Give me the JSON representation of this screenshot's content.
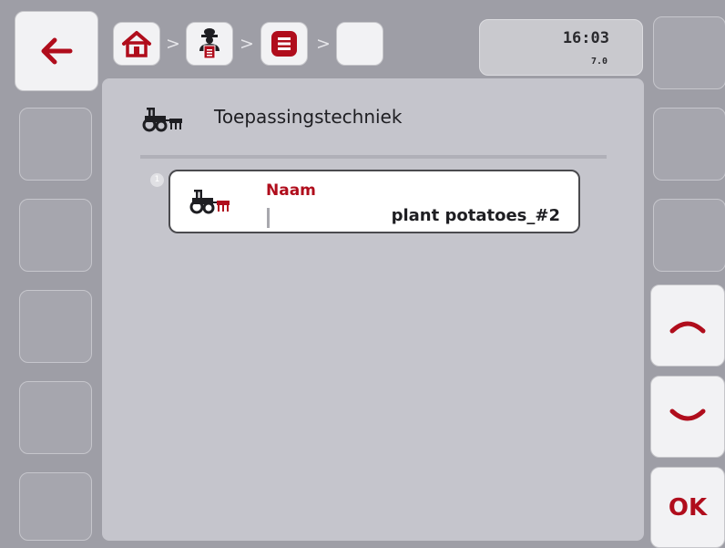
{
  "nav": {
    "back_icon": "arrow-left-icon"
  },
  "breadcrumbs": [
    {
      "icon": "home-icon"
    },
    {
      "icon": "operator-icon"
    },
    {
      "icon": "list-menu-icon"
    },
    {
      "icon": ""
    }
  ],
  "breadcrumb_separator": ">",
  "status": {
    "time": "16:03",
    "version": "7.0"
  },
  "header": {
    "title": "Toepassingstechniek",
    "icon": "tractor-implement-icon"
  },
  "list": {
    "items": [
      {
        "index": "1",
        "label": "Naam",
        "value": "plant potatoes_#2",
        "icon": "tractor-implement-icon"
      }
    ]
  },
  "softkeys": {
    "scroll_up_icon": "chevron-up-icon",
    "scroll_down_icon": "chevron-down-icon",
    "ok_label": "OK"
  },
  "colors": {
    "accent": "#b00d1c",
    "background": "#9e9ea6",
    "panel": "#c5c5cc",
    "key": "#f2f2f4"
  }
}
